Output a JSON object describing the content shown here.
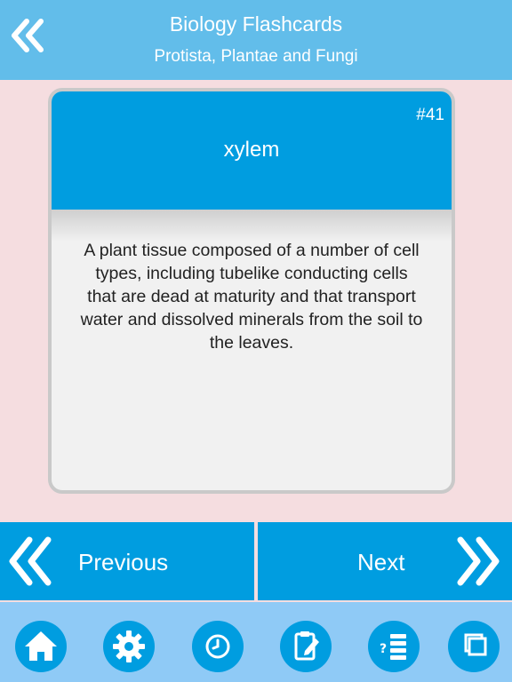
{
  "header": {
    "title": "Biology Flashcards",
    "subtitle": "Protista, Plantae and Fungi",
    "back_icon": "double-chevron-left-icon"
  },
  "card": {
    "number": "#41",
    "term": "xylem",
    "definition_lines": [
      "A plant tissue composed of a number of cell",
      "types, including tubelike conducting cells",
      "that are dead at maturity and that transport",
      "water and dissolved minerals from the soil to",
      "the leaves."
    ]
  },
  "navigation": {
    "previous_label": "Previous",
    "next_label": "Next"
  },
  "toolbar": {
    "items": [
      "home-icon",
      "gear-icon",
      "clock-icon",
      "edit-note-icon",
      "quiz-list-icon",
      "copy-icon"
    ]
  },
  "colors": {
    "header": "#62bdea",
    "accent": "#009de0",
    "background": "#f5dde0",
    "footer": "#8fcaf6"
  }
}
